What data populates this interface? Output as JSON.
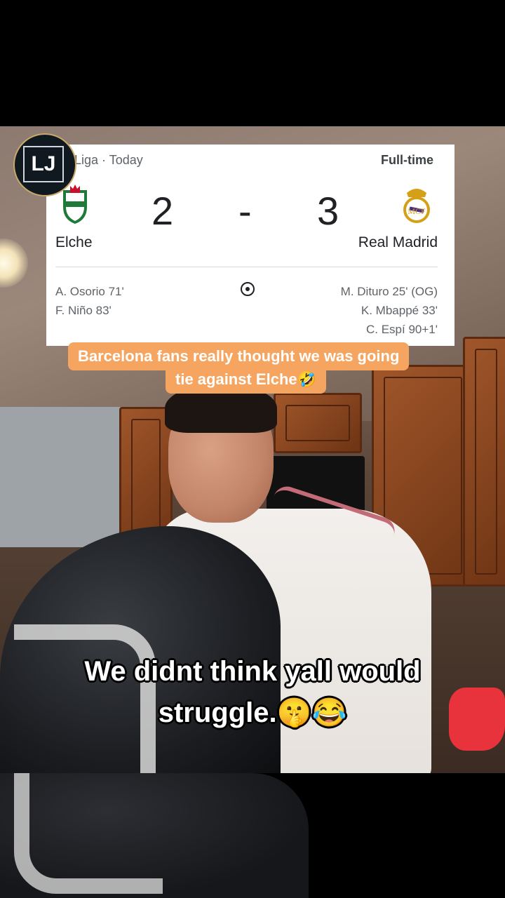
{
  "scorecard": {
    "league": "Liga · Today",
    "status": "Full-time",
    "home": {
      "name": "Elche",
      "score": "2",
      "scorers": [
        "A. Osorio 71'",
        "F. Niño 83'"
      ]
    },
    "separator": "-",
    "away": {
      "name": "Real Madrid",
      "score": "3",
      "scorers": [
        "M. Dituro 25' (OG)",
        "K. Mbappé 33'",
        "C. Espí 90+1'"
      ]
    }
  },
  "channel_logo": {
    "text": "LJ"
  },
  "caption": {
    "line1": "Barcelona fans really thought we was going",
    "line2": "tie against Elche🤣"
  },
  "subtitle": {
    "line1": "We didnt think yall would",
    "line2": "struggle.🤫😂"
  }
}
